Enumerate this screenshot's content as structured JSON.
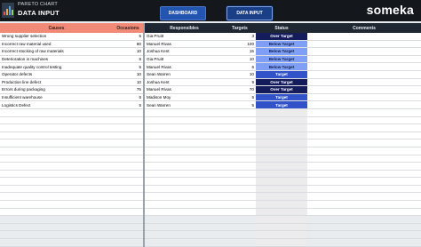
{
  "header": {
    "subtitle": "PARETO CHART",
    "title": "DATA INPUT",
    "dashboard_btn": "DASHBOARD",
    "data_input_btn": "DATA INPUT",
    "brand": "someka"
  },
  "table": {
    "headers": {
      "causes": "Causes",
      "occasions": "Occasions",
      "responsibles": "Responsibles",
      "targets": "Targets",
      "status": "Status",
      "comments": "Comments"
    },
    "rows": [
      {
        "cause": "Wrong supplier selection",
        "occ": "5",
        "resp": "Gia Pruitt",
        "target": "3",
        "status": "Over Target",
        "kind": "over"
      },
      {
        "cause": "Incorrect raw material used",
        "occ": "80",
        "resp": "Manuel Rivas",
        "target": "100",
        "status": "Below Target",
        "kind": "below"
      },
      {
        "cause": "Incorrect stocking of raw materials",
        "occ": "10",
        "resp": "Joshua Kent",
        "target": "15",
        "status": "Below Target",
        "kind": "below"
      },
      {
        "cause": "Deterioration in machines",
        "occ": "5",
        "resp": "Gia Pruitt",
        "target": "10",
        "status": "Below Target",
        "kind": "below"
      },
      {
        "cause": "Inadequate quality control testing",
        "occ": "5",
        "resp": "Manuel Rivas",
        "target": "6",
        "status": "Below Target",
        "kind": "below"
      },
      {
        "cause": "Operator defects",
        "occ": "10",
        "resp": "Sean Warren",
        "target": "10",
        "status": "Target",
        "kind": "target"
      },
      {
        "cause": "Production line defect",
        "occ": "10",
        "resp": "Joshua Kent",
        "target": "9",
        "status": "Over Target",
        "kind": "over"
      },
      {
        "cause": "Errors during packaging",
        "occ": "75",
        "resp": "Manuel Rivas",
        "target": "70",
        "status": "Over Target",
        "kind": "over"
      },
      {
        "cause": "Insufficient warehouse",
        "occ": "5",
        "resp": "Madison Moy",
        "target": "5",
        "status": "Target",
        "kind": "target"
      },
      {
        "cause": "Logistics Defect",
        "occ": "5",
        "resp": "Sean Warren",
        "target": "5",
        "status": "Target",
        "kind": "target"
      }
    ],
    "empty_rows": 18
  },
  "colors": {
    "over": "#141c5b",
    "below": "#7f9ef5",
    "target": "#3152c8",
    "header_red": "#f28a78",
    "header_dark": "#1f2733"
  }
}
